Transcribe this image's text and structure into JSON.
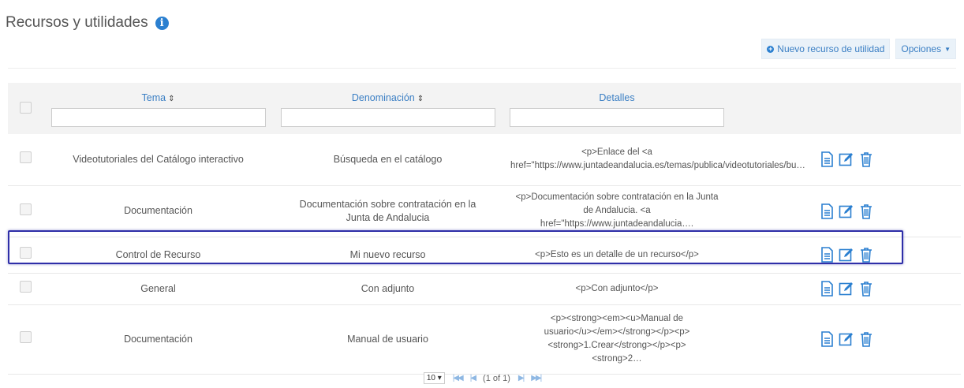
{
  "page": {
    "title": "Recursos y utilidades"
  },
  "toolbar": {
    "new_label": "Nuevo recurso de utilidad",
    "options_label": "Opciones"
  },
  "table": {
    "headers": {
      "tema": "Tema",
      "denominacion": "Denominación",
      "detalles": "Detalles"
    },
    "rows": [
      {
        "tema": "Videotutoriales del Catálogo interactivo",
        "denominacion": "Búsqueda en el catálogo",
        "detalles": "<p>Enlace del <a href=\"https://www.juntadeandalucia.es/temas/publica/videotutoriales/bu…"
      },
      {
        "tema": "Documentación",
        "denominacion": "Documentación sobre contratación en la Junta de Andalucia",
        "detalles": "<p>Documentación sobre contratación en la Junta de Andalucia. <a href=\"https://www.juntadeandalucia…."
      },
      {
        "tema": "Control de Recurso",
        "denominacion": "Mi nuevo recurso",
        "detalles": "<p>Esto es un detalle de un recurso</p>"
      },
      {
        "tema": "General",
        "denominacion": "Con adjunto",
        "detalles": "<p>Con adjunto</p>"
      },
      {
        "tema": "Documentación",
        "denominacion": "Manual de usuario",
        "detalles": "<p><strong><em><u>Manual de usuario</u></em></strong></p><p><strong>1.Crear</strong></p><p><strong>2…"
      }
    ]
  },
  "pager": {
    "page_size": "10",
    "page_info": "(1 of 1)"
  },
  "colors": {
    "accent": "#2a7fd0",
    "highlight_border": "#2f2fa8"
  }
}
